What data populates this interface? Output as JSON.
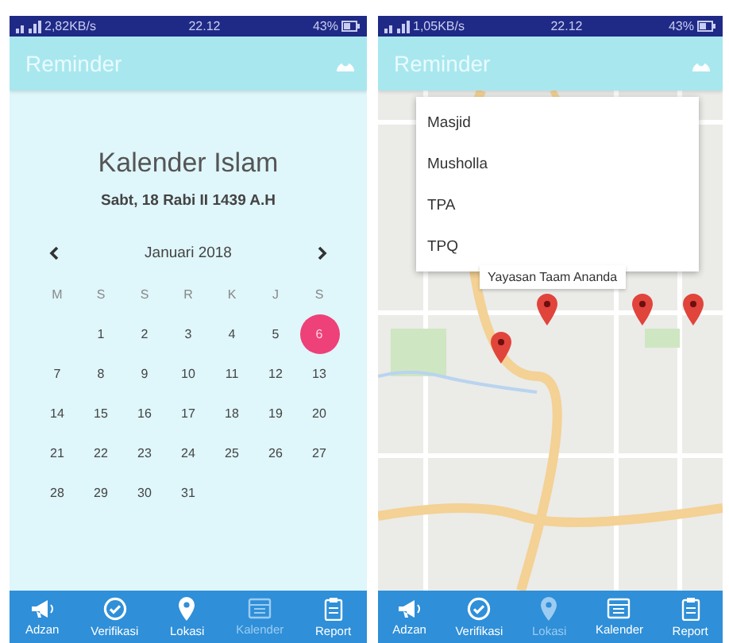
{
  "screens": [
    {
      "kind": "calendar",
      "status_bar": {
        "speed": "2,82KB/s",
        "time": "22.12",
        "battery": "43%"
      },
      "app_bar": {
        "title": "Reminder"
      },
      "calendar": {
        "title": "Kalender Islam",
        "hijri_date": "Sabt, 18 Rabi II 1439 A.H",
        "month": "Januari 2018",
        "weekdays": [
          "M",
          "S",
          "S",
          "R",
          "K",
          "J",
          "S"
        ],
        "weeks": [
          [
            {
              "day": "1",
              "selected": false
            },
            {
              "day": "2",
              "selected": false
            },
            {
              "day": "3",
              "selected": false
            },
            {
              "day": "4",
              "selected": false
            },
            {
              "day": "5",
              "selected": false
            },
            {
              "day": "6",
              "selected": true
            }
          ],
          [
            {
              "day": "7",
              "selected": false
            },
            {
              "day": "8",
              "selected": false
            },
            {
              "day": "9",
              "selected": false
            },
            {
              "day": "10",
              "selected": false
            },
            {
              "day": "11",
              "selected": false
            },
            {
              "day": "12",
              "selected": false
            },
            {
              "day": "13",
              "selected": false
            }
          ],
          [
            {
              "day": "14",
              "selected": false
            },
            {
              "day": "15",
              "selected": false
            },
            {
              "day": "16",
              "selected": false
            },
            {
              "day": "17",
              "selected": false
            },
            {
              "day": "18",
              "selected": false
            },
            {
              "day": "19",
              "selected": false
            },
            {
              "day": "20",
              "selected": false
            }
          ],
          [
            {
              "day": "21",
              "selected": false
            },
            {
              "day": "22",
              "selected": false
            },
            {
              "day": "23",
              "selected": false
            },
            {
              "day": "24",
              "selected": false
            },
            {
              "day": "25",
              "selected": false
            },
            {
              "day": "26",
              "selected": false
            },
            {
              "day": "27",
              "selected": false
            }
          ],
          [
            {
              "day": "28",
              "selected": false
            },
            {
              "day": "29",
              "selected": false
            },
            {
              "day": "30",
              "selected": false
            },
            {
              "day": "31",
              "selected": false
            }
          ]
        ]
      },
      "nav": [
        {
          "kind": "megaphone",
          "label": "Adzan",
          "selected": false
        },
        {
          "kind": "check",
          "label": "Verifikasi",
          "selected": false
        },
        {
          "kind": "pin",
          "label": "Lokasi",
          "selected": false
        },
        {
          "kind": "calendar",
          "label": "Kalender",
          "selected": true
        },
        {
          "kind": "clipboard",
          "label": "Report",
          "selected": false
        }
      ]
    },
    {
      "kind": "map",
      "status_bar": {
        "speed": "1,05KB/s",
        "time": "22.12",
        "battery": "43%"
      },
      "app_bar": {
        "title": "Reminder"
      },
      "map": {
        "menu": [
          "Masjid",
          "Musholla",
          "TPA",
          "TPQ"
        ],
        "info_window": "Yayasan Taam Ananda"
      },
      "nav": [
        {
          "kind": "megaphone",
          "label": "Adzan",
          "selected": false
        },
        {
          "kind": "check",
          "label": "Verifikasi",
          "selected": false
        },
        {
          "kind": "pin",
          "label": "Lokasi",
          "selected": true
        },
        {
          "kind": "calendar",
          "label": "Kalender",
          "selected": false
        },
        {
          "kind": "clipboard",
          "label": "Report",
          "selected": false
        }
      ]
    }
  ]
}
